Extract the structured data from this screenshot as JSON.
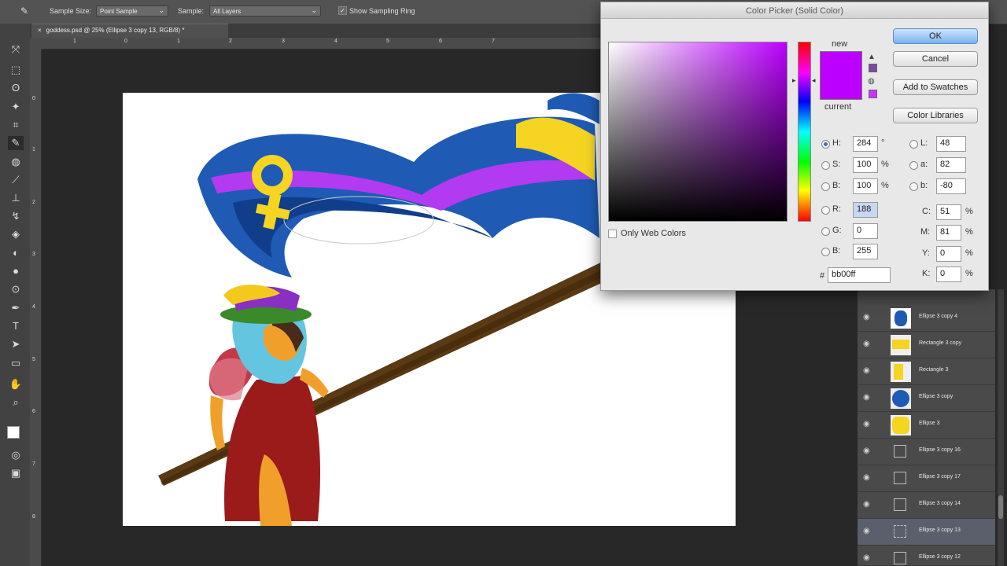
{
  "options_bar": {
    "sample_size_label": "Sample Size:",
    "sample_size_value": "Point Sample",
    "sample_label": "Sample:",
    "sample_value": "All Layers",
    "show_ring_label": "Show Sampling Ring"
  },
  "document": {
    "tab_title": "goddess.psd @ 25% (Ellipse 3 copy 13, RGB/8) *"
  },
  "rulers": {
    "horizontal": [
      "1",
      "0",
      "1",
      "2",
      "3",
      "4",
      "5",
      "6",
      "7"
    ],
    "vertical": [
      "0",
      "1",
      "2",
      "3",
      "4",
      "5",
      "6",
      "7",
      "8"
    ]
  },
  "color_picker": {
    "title": "Color Picker (Solid Color)",
    "new_label": "new",
    "current_label": "current",
    "new_color": "#bb00ff",
    "current_color": "#bb00ff",
    "buttons": {
      "ok": "OK",
      "cancel": "Cancel",
      "add_swatches": "Add to Swatches",
      "color_libraries": "Color Libraries"
    },
    "only_web_colors": "Only Web Colors",
    "hsb": {
      "h_label": "H:",
      "h": "284",
      "h_unit": "°",
      "s_label": "S:",
      "s": "100",
      "s_unit": "%",
      "b_label": "B:",
      "b": "100",
      "b_unit": "%"
    },
    "rgb": {
      "r_label": "R:",
      "r": "188",
      "g_label": "G:",
      "g": "0",
      "b_label": "B:",
      "b": "255"
    },
    "lab": {
      "l_label": "L:",
      "l": "48",
      "a_label": "a:",
      "a": "82",
      "b_label": "b:",
      "b": "-80"
    },
    "cmyk": {
      "c_label": "C:",
      "c": "51",
      "m_label": "M:",
      "m": "81",
      "y_label": "Y:",
      "y": "0",
      "k_label": "K:",
      "k": "0",
      "unit": "%"
    },
    "hex_label": "#",
    "hex": "bb00ff"
  },
  "layers": [
    {
      "name": "Ellipse 3 copy 4"
    },
    {
      "name": "Rectangle 3 copy"
    },
    {
      "name": "Rectangle 3"
    },
    {
      "name": "Ellipse 3 copy"
    },
    {
      "name": "Ellipse 3"
    },
    {
      "name": "Ellipse 3 copy 16"
    },
    {
      "name": "Ellipse 3 copy 17"
    },
    {
      "name": "Ellipse 3 copy 14"
    },
    {
      "name": "Ellipse 3 copy 13"
    },
    {
      "name": "Ellipse 3 copy 12"
    }
  ],
  "colors": {
    "flag_blue": "#1f5bb4",
    "flag_purple": "#b23af0",
    "flag_yellow": "#f5d422",
    "pole_brown": "#5a3a14",
    "dress_red": "#9b1a1a"
  }
}
